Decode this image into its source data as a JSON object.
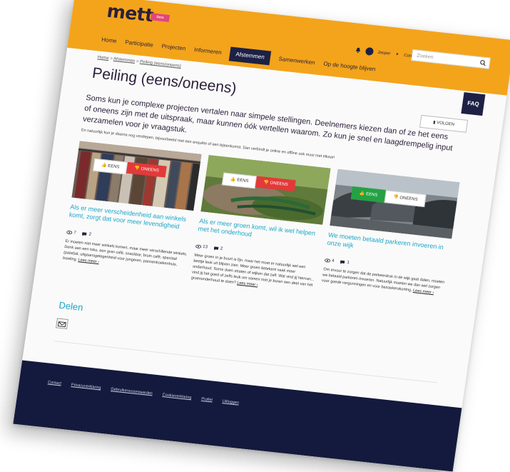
{
  "header": {
    "logo": "mett",
    "logo_badge": "Beta",
    "nav": [
      "Home",
      "Participatie",
      "Projecten",
      "Informeren",
      "Afstemmen",
      "Samenwerken",
      "Op de hoogte blijven"
    ],
    "active_nav": "Afstemmen",
    "user_name": "Jasper",
    "contact": "Contact",
    "search_placeholder": "Zoeken"
  },
  "breadcrumb": {
    "items": [
      "Home",
      "Afstemmen",
      "Peiling (eens/oneens)"
    ],
    "separator": ">"
  },
  "faq_label": "FAQ",
  "page": {
    "title": "Peiling (eens/oneens)",
    "follow_label": "VOLGEN",
    "intro": "Soms kun je complexe projecten vertalen naar simpele stellingen. Deelnemers kiezen dan of ze het eens of oneens zijn met de uitspraak, maar kunnen óók vertellen waarom. Zo kun je snel en laagdrempelig input verzamelen voor je vraagstuk.",
    "sub_intro": "En natuurlijk kun je daarna nog verdiepen, bijvoorbeeld met een enquête of een bijeenkomst. Dan verbindt je online en offline ook mooi met elkaar!"
  },
  "cards": [
    {
      "title": "Als er meer verscheidenheid aan winkels komt, zorgt dat voor meer levendigheid",
      "eens_label": "EENS",
      "oneens_label": "ONEENS",
      "selected": "oneens",
      "views": "7",
      "comments": "2",
      "body": "Er moeten niet meer winkels komen, maar meer verschillende winkels. Denk aan een toko, een gran café, snackbar, bruin café, speciaal (patat)al, uitgaansgelegenheid voor jongeren, pannenkoekenhuis, bowling.",
      "read_more": "Lees meer ›"
    },
    {
      "title": "Als er meer groen komt, wil ik wel helpen met het onderhoud",
      "eens_label": "EENS",
      "oneens_label": "ONEENS",
      "selected": "oneens",
      "views": "13",
      "comments": "2",
      "body": "Meer groen in je buurt is fijn, maar het moet er natuurlijk wel een beetje leuk uit blijven zien. Meer groen betekent vaak meer onderhoud. Soms doen straten of wijken dat zelf. Wat vind jij hiervan... vind jij het goed of zelfs leuk om samen met je buren een deel van het groenonderhoud te doen?",
      "read_more": "Lees meer ›"
    },
    {
      "title": "We moeten betaald parkeren invoeren in onze wijk",
      "eens_label": "EENS",
      "oneens_label": "ONEENS",
      "selected": "eens",
      "views": "4",
      "comments": "1",
      "body": "Om ervoor te zorgen dat de parkeerdruk in de wijk gaat dalen, moeten we betaald parkeren invoeren. Natuurlijk moeten we dan wel zorgen voor goede vergunningen en voor bezoekerskorting.",
      "read_more": "Lees meer ›"
    }
  ],
  "share": {
    "title": "Delen"
  },
  "footer": {
    "links": [
      "Contact",
      "Privacyverklaring",
      "Gebruikersvoorwaarden",
      "Cookieverklaring",
      "Profiel",
      "Uitloggen"
    ]
  },
  "colors": {
    "header_bg": "#f3a41b",
    "nav_active_bg": "#1c2145",
    "link_accent": "#1aa6c8",
    "vote_oneens": "#e23a3a",
    "vote_eens": "#25a244",
    "footer_bg": "#141a3d",
    "badge": "#e0477b"
  }
}
